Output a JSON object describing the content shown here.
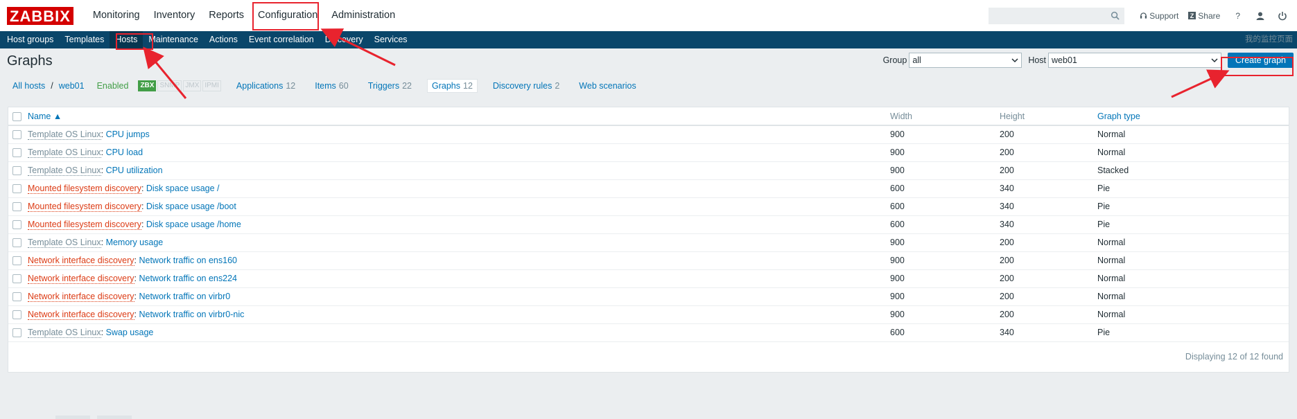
{
  "logo": "ZABBIX",
  "main_menu": [
    "Monitoring",
    "Inventory",
    "Reports",
    "Configuration",
    "Administration"
  ],
  "search": {
    "placeholder": "",
    "value": ""
  },
  "top_links": {
    "support": "Support",
    "share": "Share",
    "help": "?"
  },
  "sub_menu": [
    "Host groups",
    "Templates",
    "Hosts",
    "Maintenance",
    "Actions",
    "Event correlation",
    "Discovery",
    "Services"
  ],
  "sub_corner": "我的监控页面",
  "page": {
    "title": "Graphs"
  },
  "filters": {
    "group_label": "Group",
    "group_value": "all",
    "host_label": "Host",
    "host_value": "web01",
    "create_button": "Create graph"
  },
  "host_nav": {
    "all_hosts": "All hosts",
    "separator": "/",
    "host": "web01",
    "status": "Enabled",
    "availability": [
      "ZBX",
      "SNMP",
      "JMX",
      "IPMI"
    ],
    "tabs": [
      {
        "label": "Applications",
        "count": "12"
      },
      {
        "label": "Items",
        "count": "60"
      },
      {
        "label": "Triggers",
        "count": "22"
      },
      {
        "label": "Graphs",
        "count": "12"
      },
      {
        "label": "Discovery rules",
        "count": "2"
      },
      {
        "label": "Web scenarios",
        "count": ""
      }
    ]
  },
  "table": {
    "headers": {
      "name": "Name ▲",
      "width": "Width",
      "height": "Height",
      "type": "Graph type"
    },
    "rows": [
      {
        "prefix": "Template OS Linux",
        "ptype": "tmpl",
        "name": "CPU jumps",
        "width": "900",
        "height": "200",
        "type": "Normal"
      },
      {
        "prefix": "Template OS Linux",
        "ptype": "tmpl",
        "name": "CPU load",
        "width": "900",
        "height": "200",
        "type": "Normal"
      },
      {
        "prefix": "Template OS Linux",
        "ptype": "tmpl",
        "name": "CPU utilization",
        "width": "900",
        "height": "200",
        "type": "Stacked"
      },
      {
        "prefix": "Mounted filesystem discovery",
        "ptype": "disc",
        "name": "Disk space usage /",
        "width": "600",
        "height": "340",
        "type": "Pie"
      },
      {
        "prefix": "Mounted filesystem discovery",
        "ptype": "disc",
        "name": "Disk space usage /boot",
        "width": "600",
        "height": "340",
        "type": "Pie"
      },
      {
        "prefix": "Mounted filesystem discovery",
        "ptype": "disc",
        "name": "Disk space usage /home",
        "width": "600",
        "height": "340",
        "type": "Pie"
      },
      {
        "prefix": "Template OS Linux",
        "ptype": "tmpl",
        "name": "Memory usage",
        "width": "900",
        "height": "200",
        "type": "Normal"
      },
      {
        "prefix": "Network interface discovery",
        "ptype": "disc",
        "name": "Network traffic on ens160",
        "width": "900",
        "height": "200",
        "type": "Normal"
      },
      {
        "prefix": "Network interface discovery",
        "ptype": "disc",
        "name": "Network traffic on ens224",
        "width": "900",
        "height": "200",
        "type": "Normal"
      },
      {
        "prefix": "Network interface discovery",
        "ptype": "disc",
        "name": "Network traffic on virbr0",
        "width": "900",
        "height": "200",
        "type": "Normal"
      },
      {
        "prefix": "Network interface discovery",
        "ptype": "disc",
        "name": "Network traffic on virbr0-nic",
        "width": "900",
        "height": "200",
        "type": "Normal"
      },
      {
        "prefix": "Template OS Linux",
        "ptype": "tmpl",
        "name": "Swap usage",
        "width": "600",
        "height": "340",
        "type": "Pie"
      }
    ],
    "footer": "Displaying 12 of 12 found"
  },
  "colors": {
    "brand": "#d40000",
    "subnav": "#0a466a",
    "link": "#0275b8",
    "discovery": "#dc3b14",
    "annotation": "#e8232e"
  }
}
